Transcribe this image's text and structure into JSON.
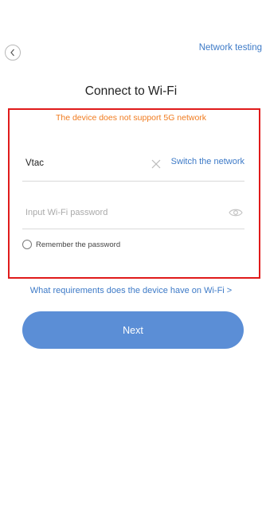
{
  "header": {
    "back_icon": "chevron-left-icon",
    "network_testing_label": "Network testing",
    "title": "Connect to Wi-Fi"
  },
  "form": {
    "warning_text": "The device does not support 5G network",
    "ssid_value": "Vtac",
    "clear_icon": "close-icon",
    "switch_network_label": "Switch the network",
    "password_placeholder": "Input Wi-Fi password",
    "password_value": "",
    "eye_icon": "eye-icon",
    "remember_password_label": "Remember the password",
    "remember_password_checked": false
  },
  "requirements_link_label": "What requirements does the device have on Wi-Fi >",
  "next_button_label": "Next",
  "colors": {
    "accent": "#3d7ac7",
    "button": "#5b8ed6",
    "warning": "#f07b1f",
    "highlight_border": "#e01b1b"
  }
}
